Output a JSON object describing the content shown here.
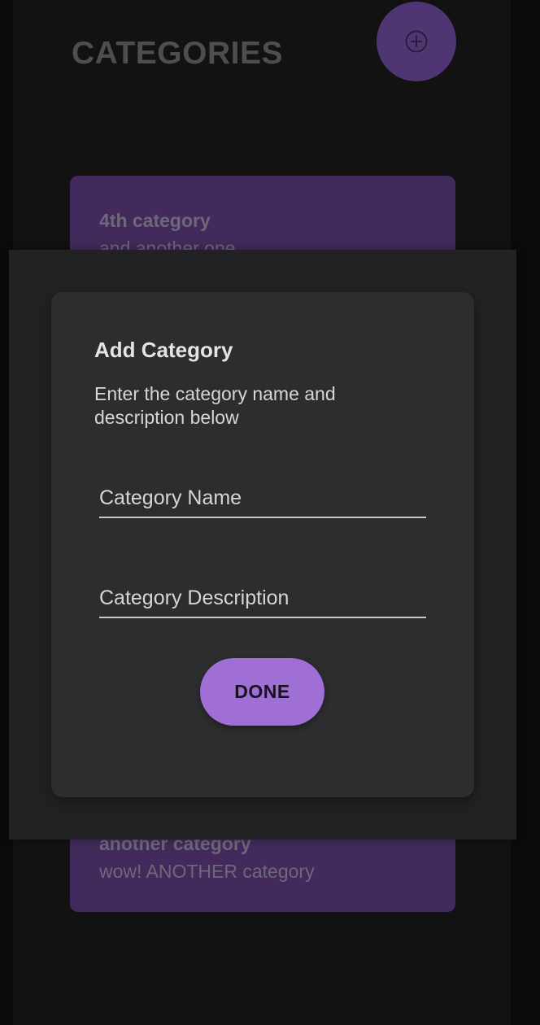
{
  "screen": {
    "title": "CATEGORIES",
    "fab_icon": "add-circle-icon",
    "accent_color": "#9f6fd6",
    "card_color": "#422b5c"
  },
  "categories": [
    {
      "title": "4th category",
      "description": "and another one"
    },
    {
      "title": "another category",
      "description": "wow! ANOTHER category"
    }
  ],
  "dialog": {
    "title": "Add Category",
    "message": "Enter the category name and description below",
    "name_placeholder": "Category Name",
    "description_placeholder": "Category Description",
    "done_label": "DONE"
  }
}
